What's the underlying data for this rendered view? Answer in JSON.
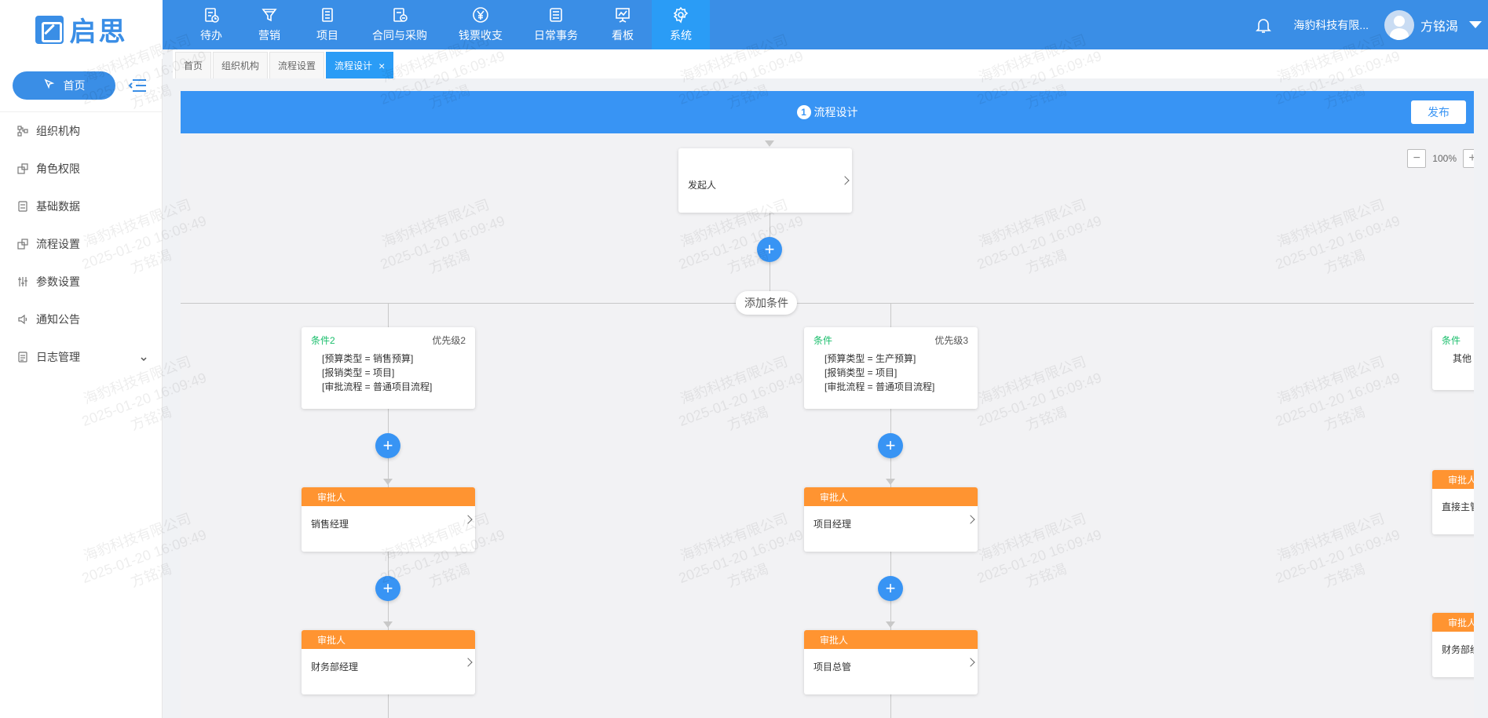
{
  "brand": {
    "name": "启思",
    "color": "#3a8ee6"
  },
  "nav": [
    {
      "label": "待办",
      "icon": "todo-icon"
    },
    {
      "label": "营销",
      "icon": "funnel-icon"
    },
    {
      "label": "项目",
      "icon": "project-icon"
    },
    {
      "label": "合同与采购",
      "icon": "contract-icon"
    },
    {
      "label": "钱票收支",
      "icon": "yen-icon"
    },
    {
      "label": "日常事务",
      "icon": "list-icon"
    },
    {
      "label": "看板",
      "icon": "board-icon"
    },
    {
      "label": "系统",
      "icon": "gear-icon",
      "active": true
    }
  ],
  "header": {
    "company": "海豹科技有限...",
    "username": "方铭渴"
  },
  "sidebar": {
    "home_label": "首页",
    "items": [
      {
        "label": "组织机构",
        "icon": "org-icon"
      },
      {
        "label": "角色权限",
        "icon": "role-icon"
      },
      {
        "label": "基础数据",
        "icon": "data-icon"
      },
      {
        "label": "流程设置",
        "icon": "flow-icon"
      },
      {
        "label": "参数设置",
        "icon": "params-icon"
      },
      {
        "label": "通知公告",
        "icon": "notice-icon"
      },
      {
        "label": "日志管理",
        "icon": "log-icon"
      }
    ]
  },
  "tabs": [
    {
      "label": "首页"
    },
    {
      "label": "组织机构"
    },
    {
      "label": "流程设置"
    },
    {
      "label": "流程设计",
      "active": true,
      "close": "×"
    }
  ],
  "panel": {
    "step_num": "1",
    "title": "流程设计",
    "publish_label": "发布",
    "zoom_minus": "−",
    "zoom_plus": "+",
    "zoom_level": "100%"
  },
  "flow": {
    "start_label": "发起人",
    "plus": "+",
    "add_condition_label": "添加条件",
    "conditions": [
      {
        "title": "条件2",
        "priority": "优先级2",
        "lines": [
          "[预算类型 = 销售预算]",
          "[报销类型 = 项目]",
          "[审批流程 = 普通项目流程]"
        ],
        "approvers": [
          {
            "head": "审批人",
            "name": "销售经理"
          },
          {
            "head": "审批人",
            "name": "财务部经理"
          }
        ]
      },
      {
        "title": "条件",
        "priority": "优先级3",
        "lines": [
          "[预算类型 = 生产预算]",
          "[报销类型 = 项目]",
          "[审批流程 = 普通项目流程]"
        ],
        "approvers": [
          {
            "head": "审批人",
            "name": "项目经理"
          },
          {
            "head": "审批人",
            "name": "项目总管"
          }
        ]
      },
      {
        "title": "条件",
        "line": "其他",
        "approvers": [
          {
            "head": "审批人",
            "name": "直接主管"
          },
          {
            "head": "审批人",
            "name": "财务部经"
          }
        ]
      }
    ]
  },
  "watermark": {
    "line1": "海豹科技有限公司",
    "line2": "2025-01-20 16:09:49",
    "line3": "方铭渴"
  },
  "colors": {
    "primary": "#3894f4",
    "approver": "#ff9431",
    "condition": "#19be6b"
  }
}
